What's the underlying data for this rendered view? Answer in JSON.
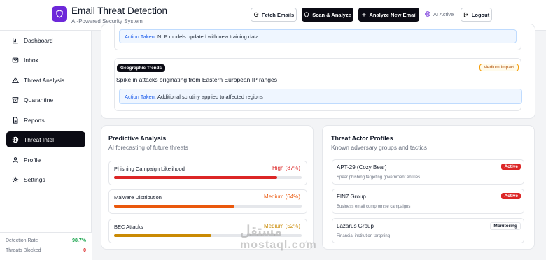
{
  "app": {
    "title": "Email Threat Detection",
    "subtitle": "AI-Powered Security System",
    "logo_icon": "shield-icon",
    "brand_color": "#6d28d9"
  },
  "header": {
    "fetch_label": "Fetch Emails",
    "scan_label": "Scan & Analyze",
    "analyze_label": "Analyze New Email",
    "ai_status": "AI Active",
    "logout_label": "Logout"
  },
  "sidebar": {
    "items": [
      {
        "label": "Dashboard",
        "icon": "bar-chart-icon"
      },
      {
        "label": "Inbox",
        "icon": "mail-icon"
      },
      {
        "label": "Threat Analysis",
        "icon": "warning-icon"
      },
      {
        "label": "Quarantine",
        "icon": "archive-icon"
      },
      {
        "label": "Reports",
        "icon": "document-icon"
      },
      {
        "label": "Threat Intel",
        "icon": "globe-icon",
        "active": true
      },
      {
        "label": "Profile",
        "icon": "user-icon"
      },
      {
        "label": "Settings",
        "icon": "gear-icon"
      }
    ],
    "stats": {
      "detection_label": "Detection Rate",
      "detection_value": "98.7%",
      "blocked_label": "Threats Blocked",
      "blocked_value": "0"
    }
  },
  "insights": [
    {
      "action_label": "Action Taken:",
      "action_text": "NLP models updated with new training data"
    },
    {
      "tag": "Geographic Trends",
      "impact": "Medium Impact",
      "description": "Spike in attacks originating from Eastern European IP ranges",
      "action_label": "Action Taken:",
      "action_text": "Additional scrutiny applied to affected regions"
    }
  ],
  "predictive": {
    "title": "Predictive Analysis",
    "subtitle": "AI forecasting of future threats",
    "rows": [
      {
        "label": "Phishing Campaign Likelihood",
        "level": "High (87%)",
        "value": 0.87,
        "color": "#dc2626"
      },
      {
        "label": "Malware Distribution",
        "level": "Medium (64%)",
        "value": 0.64,
        "color": "#ea580c"
      },
      {
        "label": "BEC Attacks",
        "level": "Medium (52%)",
        "value": 0.52,
        "color": "#ca8a04"
      }
    ]
  },
  "actors": {
    "title": "Threat Actor Profiles",
    "subtitle": "Known adversary groups and tactics",
    "items": [
      {
        "name": "APT-29 (Cozy Bear)",
        "description": "Spear phishing targeting government entities",
        "status": "Active"
      },
      {
        "name": "FIN7 Group",
        "description": "Business email compromise campaigns",
        "status": "Active"
      },
      {
        "name": "Lazarus Group",
        "description": "Financial institution targeting",
        "status": "Monitoring"
      }
    ]
  },
  "watermark": {
    "arabic": "مستقل",
    "latin": "mostaql.com"
  }
}
